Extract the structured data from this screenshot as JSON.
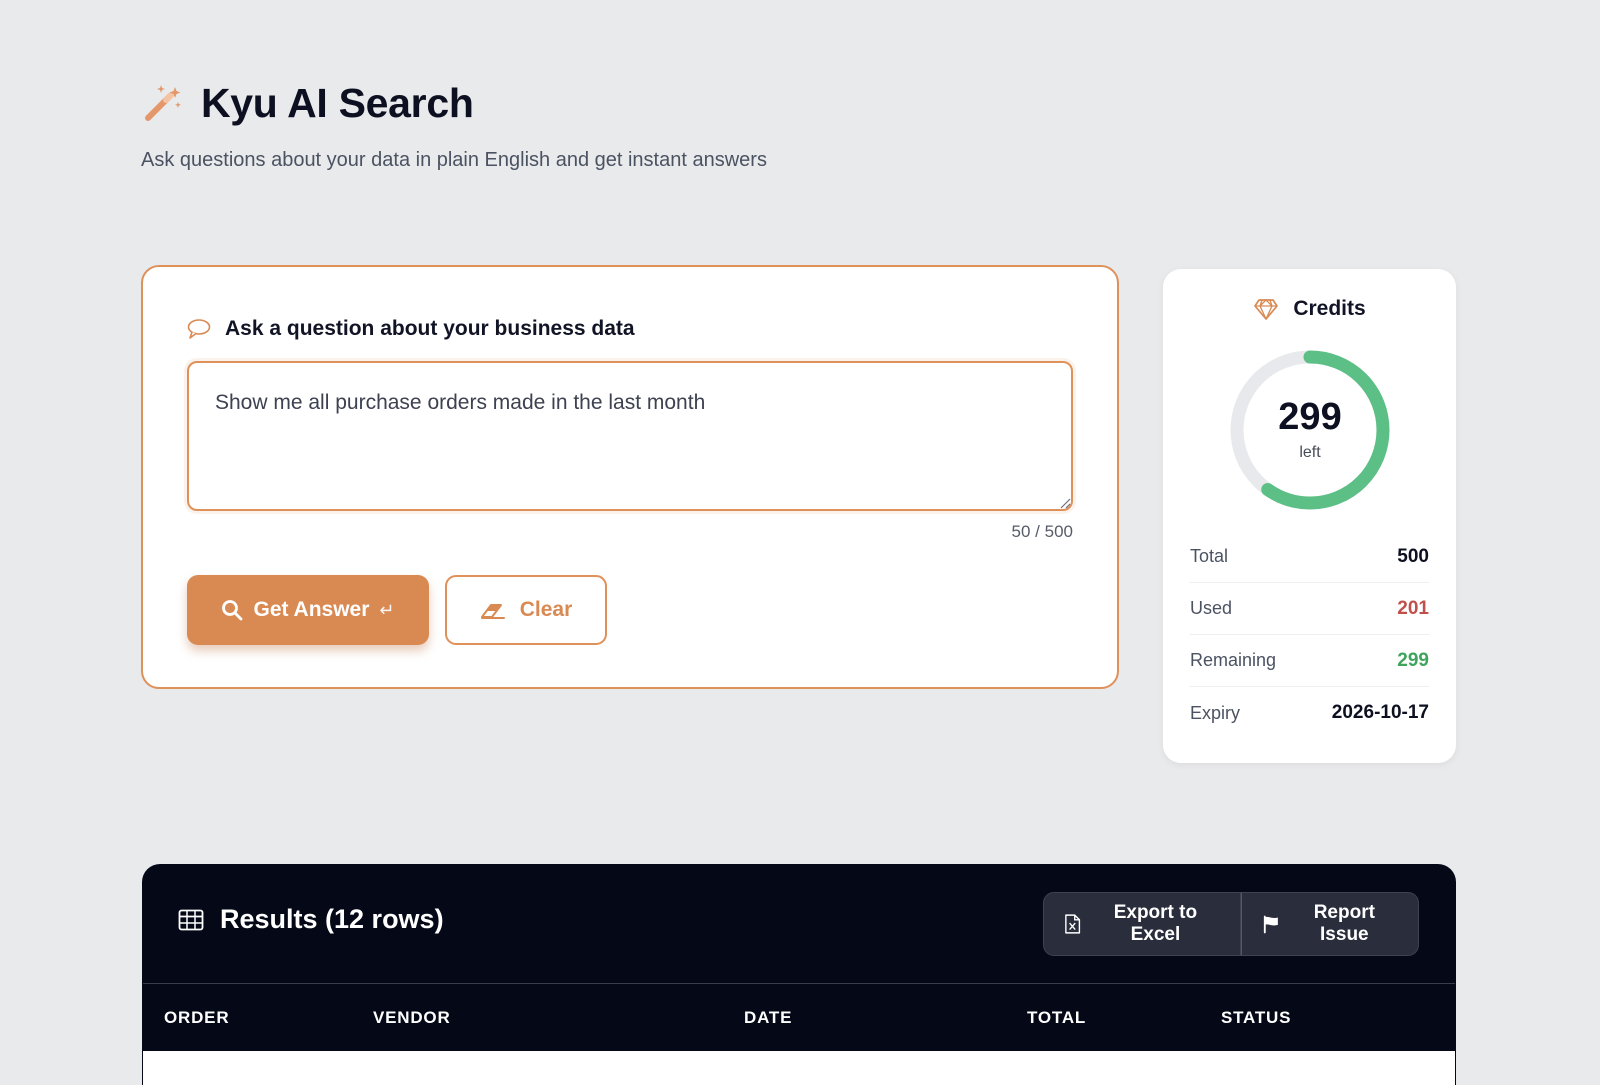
{
  "header": {
    "title": "Kyu AI Search",
    "subtitle": "Ask questions about your data in plain English and get instant answers",
    "icon": "magic-wand-icon"
  },
  "ask": {
    "label": "Ask a question about your business data",
    "query": "Show me all purchase orders made in the last month",
    "counter": "50 / 500",
    "get_answer_label": "Get Answer",
    "enter_glyph": "↵",
    "clear_label": "Clear"
  },
  "credits": {
    "title": "Credits",
    "remaining_display": "299",
    "remaining_caption": "left",
    "fraction_remaining": 0.598,
    "rows": [
      {
        "label": "Total",
        "value": "500"
      },
      {
        "label": "Used",
        "value": "201"
      },
      {
        "label": "Remaining",
        "value": "299"
      },
      {
        "label": "Expiry",
        "value": "2026-10-17"
      }
    ]
  },
  "results": {
    "title": "Results (12 rows)",
    "export_label": "Export to Excel",
    "report_label": "Report Issue",
    "columns": [
      "ORDER",
      "VENDOR",
      "DATE",
      "TOTAL",
      "STATUS"
    ]
  },
  "colors": {
    "accent": "#d98a53",
    "ring_track": "#e8e9ec",
    "ring_fill": "#5cbf85",
    "used": "#c0504d",
    "remaining": "#3fa55e",
    "results_bg": "#050817"
  }
}
